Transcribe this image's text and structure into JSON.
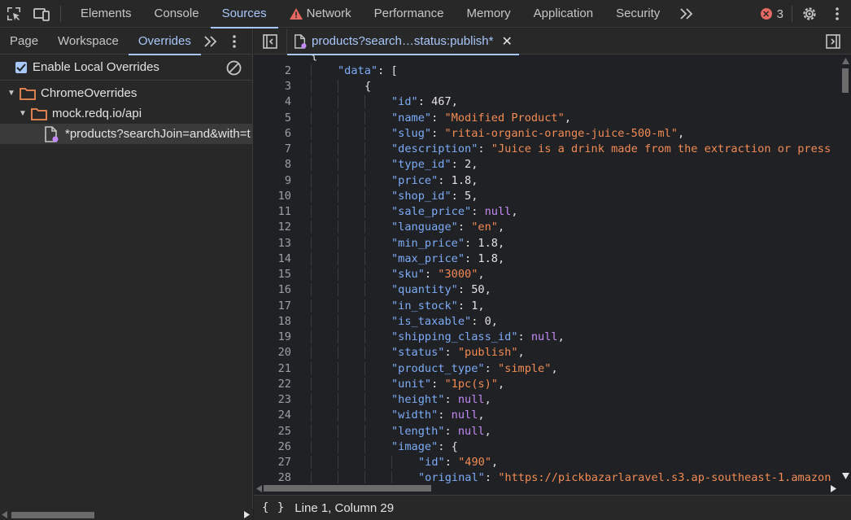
{
  "topbar": {
    "tabs": [
      {
        "label": "Elements"
      },
      {
        "label": "Console"
      },
      {
        "label": "Sources"
      },
      {
        "label": "Network"
      },
      {
        "label": "Performance"
      },
      {
        "label": "Memory"
      },
      {
        "label": "Application"
      },
      {
        "label": "Security"
      }
    ],
    "active_tab": "Sources",
    "error_count": "3"
  },
  "navigator": {
    "tabs": [
      {
        "label": "Page"
      },
      {
        "label": "Workspace"
      },
      {
        "label": "Overrides"
      }
    ],
    "active_tab": "Overrides",
    "enable_overrides_label": "Enable Local Overrides",
    "enable_overrides_checked": true,
    "tree": [
      {
        "label": "ChromeOverrides"
      },
      {
        "label": "mock.redq.io/api"
      },
      {
        "label": "*products?searchJoin=and&with=t"
      }
    ]
  },
  "editor": {
    "tab_title": "products?search…status:publish*",
    "lines": [
      {
        "n": "2",
        "depth": 1,
        "key": "data",
        "val": null,
        "tail": ": [",
        "vtype": ""
      },
      {
        "n": "3",
        "depth": 2,
        "key": null,
        "val": null,
        "tail": "{",
        "vtype": ""
      },
      {
        "n": "4",
        "depth": 3,
        "key": "id",
        "val": "467",
        "tail": ",",
        "vtype": "n"
      },
      {
        "n": "5",
        "depth": 3,
        "key": "name",
        "val": "\"Modified Product\"",
        "tail": ",",
        "vtype": "s"
      },
      {
        "n": "6",
        "depth": 3,
        "key": "slug",
        "val": "\"ritai-organic-orange-juice-500-ml\"",
        "tail": ",",
        "vtype": "s"
      },
      {
        "n": "7",
        "depth": 3,
        "key": "description",
        "val": "\"Juice is a drink made from the extraction or press",
        "tail": "",
        "vtype": "s"
      },
      {
        "n": "8",
        "depth": 3,
        "key": "type_id",
        "val": "2",
        "tail": ",",
        "vtype": "n"
      },
      {
        "n": "9",
        "depth": 3,
        "key": "price",
        "val": "1.8",
        "tail": ",",
        "vtype": "n"
      },
      {
        "n": "10",
        "depth": 3,
        "key": "shop_id",
        "val": "5",
        "tail": ",",
        "vtype": "n"
      },
      {
        "n": "11",
        "depth": 3,
        "key": "sale_price",
        "val": "null",
        "tail": ",",
        "vtype": "nl"
      },
      {
        "n": "12",
        "depth": 3,
        "key": "language",
        "val": "\"en\"",
        "tail": ",",
        "vtype": "s"
      },
      {
        "n": "13",
        "depth": 3,
        "key": "min_price",
        "val": "1.8",
        "tail": ",",
        "vtype": "n"
      },
      {
        "n": "14",
        "depth": 3,
        "key": "max_price",
        "val": "1.8",
        "tail": ",",
        "vtype": "n"
      },
      {
        "n": "15",
        "depth": 3,
        "key": "sku",
        "val": "\"3000\"",
        "tail": ",",
        "vtype": "s"
      },
      {
        "n": "16",
        "depth": 3,
        "key": "quantity",
        "val": "50",
        "tail": ",",
        "vtype": "n"
      },
      {
        "n": "17",
        "depth": 3,
        "key": "in_stock",
        "val": "1",
        "tail": ",",
        "vtype": "n"
      },
      {
        "n": "18",
        "depth": 3,
        "key": "is_taxable",
        "val": "0",
        "tail": ",",
        "vtype": "n"
      },
      {
        "n": "19",
        "depth": 3,
        "key": "shipping_class_id",
        "val": "null",
        "tail": ",",
        "vtype": "nl"
      },
      {
        "n": "20",
        "depth": 3,
        "key": "status",
        "val": "\"publish\"",
        "tail": ",",
        "vtype": "s"
      },
      {
        "n": "21",
        "depth": 3,
        "key": "product_type",
        "val": "\"simple\"",
        "tail": ",",
        "vtype": "s"
      },
      {
        "n": "22",
        "depth": 3,
        "key": "unit",
        "val": "\"1pc(s)\"",
        "tail": ",",
        "vtype": "s"
      },
      {
        "n": "23",
        "depth": 3,
        "key": "height",
        "val": "null",
        "tail": ",",
        "vtype": "nl"
      },
      {
        "n": "24",
        "depth": 3,
        "key": "width",
        "val": "null",
        "tail": ",",
        "vtype": "nl"
      },
      {
        "n": "25",
        "depth": 3,
        "key": "length",
        "val": "null",
        "tail": ",",
        "vtype": "nl"
      },
      {
        "n": "26",
        "depth": 3,
        "key": "image",
        "val": null,
        "tail": ": {",
        "vtype": ""
      },
      {
        "n": "27",
        "depth": 4,
        "key": "id",
        "val": "\"490\"",
        "tail": ",",
        "vtype": "s"
      },
      {
        "n": "28",
        "depth": 4,
        "key": "original",
        "val": "\"https://pickbazarlaravel.s3.ap-southeast-1.amazon",
        "tail": "",
        "vtype": "s"
      }
    ]
  },
  "statusbar": {
    "braces": "{ }",
    "position": "Line 1, Column 29"
  },
  "colors": {
    "accent": "#a8c7fa",
    "key": "#7cacf8",
    "string": "#f28b54",
    "null": "#c58af9",
    "error": "#e46962",
    "folder": "#f28b54"
  }
}
